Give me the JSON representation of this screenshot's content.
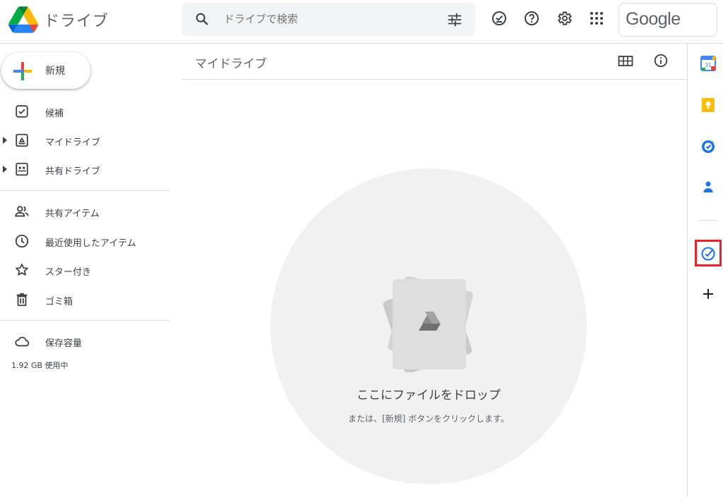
{
  "header": {
    "app_name": "ドライブ",
    "search_placeholder": "ドライブで検索",
    "brand_text": "Google"
  },
  "sidebar": {
    "new_label": "新規",
    "items": [
      {
        "label": "候補"
      },
      {
        "label": "マイドライブ"
      },
      {
        "label": "共有ドライブ"
      },
      {
        "label": "共有アイテム"
      },
      {
        "label": "最近使用したアイテム"
      },
      {
        "label": "スター付き"
      },
      {
        "label": "ゴミ箱"
      },
      {
        "label": "保存容量"
      }
    ],
    "storage_usage": "1.92 GB 使用中"
  },
  "main": {
    "title": "マイドライブ",
    "drop_title": "ここにファイルをドロップ",
    "drop_subtitle": "または、[新規] ボタンをクリックします。"
  },
  "right_panel": {
    "calendar_day": "31",
    "icons": [
      "calendar-icon",
      "keep-icon",
      "tasks-icon",
      "contacts-icon",
      "custom-app-icon",
      "add-addon-icon"
    ]
  },
  "colors": {
    "accent_blue": "#1a73e8",
    "highlight_red": "#e8222b",
    "keep_yellow": "#fbbc04"
  }
}
